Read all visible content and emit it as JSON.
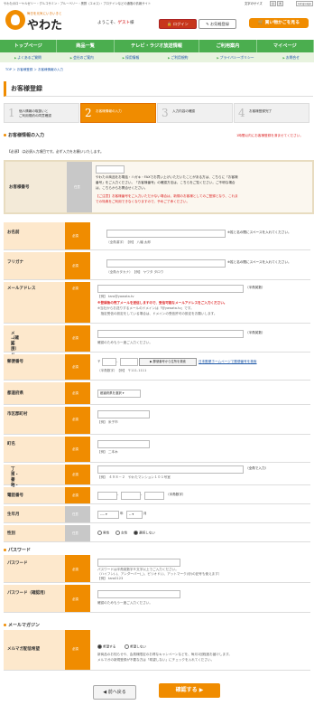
{
  "topbar": {
    "tagline": "やわたのローヤルゼリー・グルコサミン・ブルーベリー・黒酢（エキス）・プロテインなどの通販の情報サイト",
    "font_size_label": "文字のサイズ",
    "font_small": "小",
    "font_large": "大",
    "lang": "Language"
  },
  "logo": {
    "sub": "毎日を元気にいきいきと",
    "name": "やわた"
  },
  "header": {
    "welcome_prefix": "ようこそ、",
    "guest": "ゲスト",
    "welcome_suffix": "様",
    "login": "ログイン",
    "favorite": "お気軽登録",
    "cart": "買い物かごを見る"
  },
  "nav": [
    "トップページ",
    "商品一覧",
    "テレビ・ラジオ放送情報",
    "ご利用案内",
    "マイページ"
  ],
  "subnav": [
    "よくあるご質問",
    "会社のご案内",
    "採用情報",
    "ご利用規約",
    "プライバシーポリシー",
    "お問合せ"
  ],
  "breadcrumb": "TOP ＞ お客様登録 ＞ お客様情報の入力",
  "page_title": "お客様登録",
  "steps": [
    {
      "num": "1",
      "label": "個人情報の取扱いと\nご利用規約の同意確認"
    },
    {
      "num": "2",
      "label": "お客様情報の入力"
    },
    {
      "num": "3",
      "label": "入力内容の確認"
    },
    {
      "num": "4",
      "label": "お客様登録完了"
    }
  ],
  "section_customer": "お客様情報の入力",
  "notice_top": "1時間以内にお客様登録を済ませてください。",
  "required_note": "【必須】 は必須入力項目です。必ず入力をお願いいたします。",
  "customer_no": {
    "label": "お客様番号",
    "badge": "任意",
    "text1": "やわたの商品をお電話・ハガキ・FAXでお買い上げいただいたことがある方は、こちらに「お客様",
    "text2": "番号」をご入力ください。「お客様番号」の確認方法は、こちらをご覧ください。ご不明な場合",
    "text3": "は、こちらからお問合せください。",
    "text4": "【ご注意】お客様番号をご入力いただかない場合は、新規のお客様としてのご登録となり、これま",
    "text5": "での特典をご利用できなくなりますので、予めご了承ください。"
  },
  "fields": {
    "name": {
      "label": "お名前",
      "badge": "必須",
      "note": "※姓と名の間にスペースを入れてください。",
      "example": "（全角漢字）　【例】 八幡 太郎"
    },
    "kana": {
      "label": "フリガナ",
      "badge": "必須",
      "note": "※姓と名の間にスペースを入れてください。",
      "example": "（全角カタカナ）　【例】 ヤワタ タロウ"
    },
    "email": {
      "label": "メールアドレス",
      "badge": "必須",
      "hint": "（半角英数）",
      "example": "【例】 taro@yawata.tv",
      "warn1": "※登録後の完了メールを送信しますので、受信可能なメールアドレスをご入力ください。",
      "warn2": "※当社からお送りするメールのドメインは「@yawata.tv」です。",
      "warn3": "　指定受信の設定をしている場合は、ドメインの受信許可の設定をお願いします。"
    },
    "email2": {
      "label1": "メールアドレス",
      "label2": "（確認用）",
      "badge": "必須",
      "hint": "（半角英数）",
      "note": "確認のためもう一度ご入力ください。"
    },
    "zip": {
      "label": "郵便番号",
      "badge": "必須",
      "mark": "〒",
      "button": "郵便番号から住所を検索",
      "link": "日本郵便ホームページで郵便番号を検索",
      "example": "（半角数字）　【例】 〒111-1111"
    },
    "pref": {
      "label": "都道府県",
      "badge": "必須",
      "value": "都道府県を選択"
    },
    "city": {
      "label": "市区郡町村",
      "badge": "必須",
      "example": "【例】 米子市"
    },
    "town": {
      "label": "町名",
      "badge": "必須",
      "example": "【例】 二本木"
    },
    "address": {
      "label1": "丁目・番地・ビル",
      "label2": "マンション名",
      "badge": "必須",
      "hint": "（全角で入力）",
      "example": "【例】　４９８－２　やわたマンション１０１号室"
    },
    "tel": {
      "label": "電話番号",
      "badge": "必須",
      "hint": "（半角数字）"
    },
    "birth": {
      "label": "生年月",
      "badge": "任意",
      "year_value": "----",
      "year": "年",
      "month_value": "--",
      "month": "月"
    },
    "gender": {
      "label": "性別",
      "badge": "任意",
      "options": [
        "男性",
        "女性",
        "選択しない"
      ]
    }
  },
  "section_password": "パスワード",
  "password": {
    "label": "パスワード",
    "badge": "必須",
    "note1": "パスワードは半角英数字８文字以上でご入力ください。",
    "note2": "（ハイフン(-)、アンダーバー(_)、ピリオド(.)、アットマーク(@)の記号も使えます）",
    "example": "【例】 taro0123"
  },
  "password2": {
    "label": "パスワード（確認用）",
    "badge": "必須",
    "note": "確認のためもう一度ご入力ください。"
  },
  "section_mail": "メールマガジン",
  "magazine": {
    "label": "メルマガ配信希望",
    "badge": "必須",
    "options": [
      "希望する",
      "希望しない"
    ],
    "note1": "新商品のお知らせや、会員様限定のお得なキャンペーンなどを、毎月1回程度お届けします。",
    "note2": "メルマガの新規登録が不要な方は「希望しない」にチェックを入れてください。"
  },
  "buttons": {
    "back": "前へ戻る",
    "confirm": "確認する"
  }
}
